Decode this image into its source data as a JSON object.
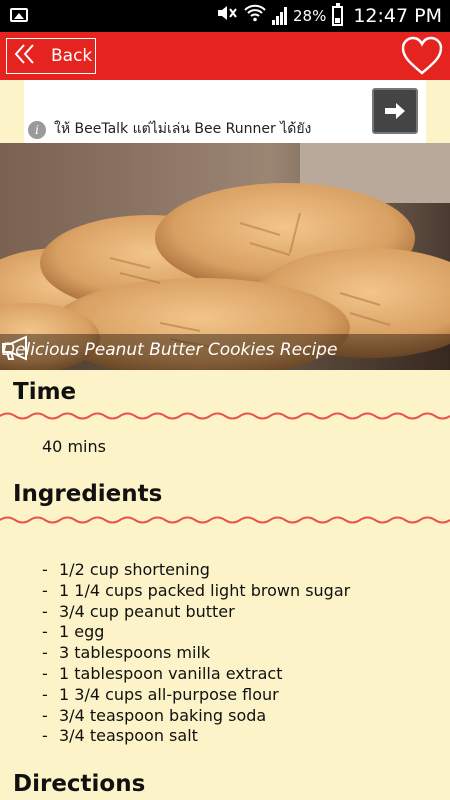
{
  "status_bar": {
    "battery_percent": "28%",
    "time": "12:47 PM",
    "icons": [
      "image-notification-icon",
      "mute-icon",
      "wifi-icon",
      "signal-icon",
      "battery-icon"
    ]
  },
  "app_bar": {
    "back_label": "Back",
    "favorite_icon": "heart-icon",
    "color": "#e52420"
  },
  "ad": {
    "text": "ให้ BeeTalk แต่ไม่เล่น Bee Runner ได้ยัง",
    "info_icon": "info-icon",
    "arrow_icon": "arrow-right-icon"
  },
  "hero": {
    "title": "Delicious Peanut Butter Cookies Recipe",
    "speak_icon": "megaphone-icon"
  },
  "sections": {
    "time": {
      "heading": "Time",
      "value": "40 mins"
    },
    "ingredients": {
      "heading": "Ingredients",
      "items": [
        "1/2 cup shortening",
        "1 1/4 cups packed light brown sugar",
        "3/4 cup peanut butter",
        "1 egg",
        "3 tablespoons milk",
        "1 tablespoon vanilla extract",
        "1 3/4 cups all-purpose flour",
        "3/4 teaspoon baking soda",
        "3/4 teaspoon salt"
      ]
    },
    "directions": {
      "heading": "Directions"
    }
  },
  "colors": {
    "background": "#fdf3c8",
    "accent": "#e52420",
    "divider": "#e8534a"
  }
}
